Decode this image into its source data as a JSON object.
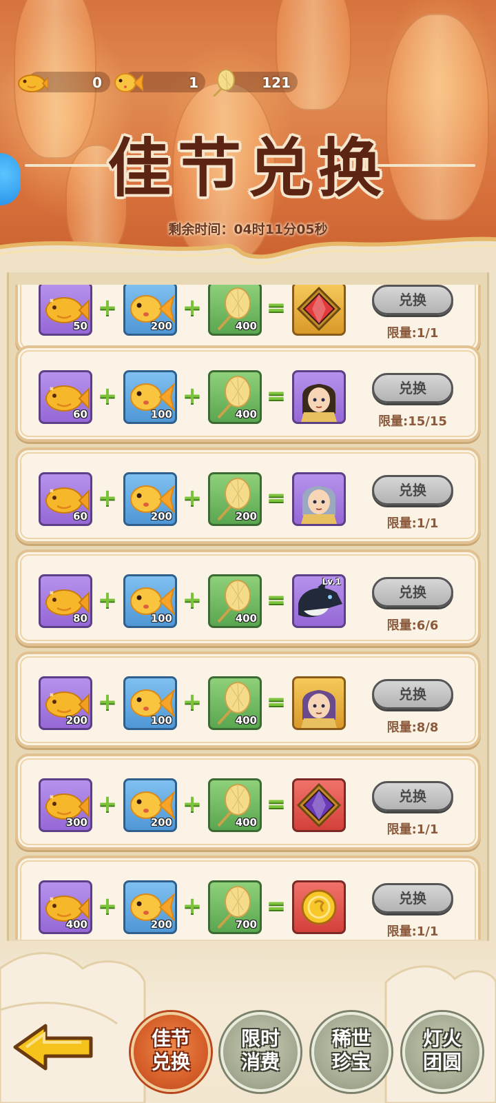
{
  "header": {
    "title": "佳节兑换",
    "timer": "剩余时间：04时11分05秒",
    "currencies": [
      {
        "icon": "golden-fish-lantern-icon",
        "value": "0"
      },
      {
        "icon": "goldfish-icon",
        "value": "1"
      },
      {
        "icon": "paper-fan-lantern-icon",
        "value": "121"
      }
    ]
  },
  "exchange_button_label": "兑换",
  "rows": [
    {
      "costs": [
        "50",
        "200",
        "400"
      ],
      "reward_icon": "red-gem-frame-icon",
      "reward_bg": "gold",
      "limit": "限量:1/1"
    },
    {
      "costs": [
        "60",
        "100",
        "400"
      ],
      "reward_icon": "hero-portrait-yellow-robed-icon",
      "reward_bg": "purple",
      "limit": "限量:15/15"
    },
    {
      "costs": [
        "60",
        "200",
        "200"
      ],
      "reward_icon": "hero-portrait-silver-helmet-icon",
      "reward_bg": "purple",
      "limit": "限量:1/1"
    },
    {
      "costs": [
        "80",
        "100",
        "400"
      ],
      "reward_icon": "orca-pet-icon",
      "reward_bg": "purple",
      "reward_level": "Lv.1",
      "limit": "限量:6/6"
    },
    {
      "costs": [
        "200",
        "100",
        "400"
      ],
      "reward_icon": "hero-portrait-purple-haired-icon",
      "reward_bg": "gold",
      "limit": "限量:8/8"
    },
    {
      "costs": [
        "300",
        "200",
        "400"
      ],
      "reward_icon": "purple-gem-frame-icon",
      "reward_bg": "red",
      "limit": "限量:1/1"
    },
    {
      "costs": [
        "400",
        "200",
        "700"
      ],
      "reward_icon": "gold-coin-orb-icon",
      "reward_bg": "red",
      "limit": "限量:1/1"
    }
  ],
  "nav": [
    {
      "line1": "佳节",
      "line2": "兑换",
      "active": true
    },
    {
      "line1": "限时",
      "line2": "消费",
      "active": false
    },
    {
      "line1": "稀世",
      "line2": "珍宝",
      "active": false
    },
    {
      "line1": "灯火",
      "line2": "团圆",
      "active": false
    }
  ],
  "colors": {
    "banner": "#d7733e",
    "title": "#5c2412",
    "card_bg": "#fbf4e6",
    "card_border": "#e2c292",
    "plus": "#7cc23a",
    "limit_text": "#8b5a3c",
    "nav_active": "#d65f2a",
    "nav_inactive": "#a4a991"
  }
}
